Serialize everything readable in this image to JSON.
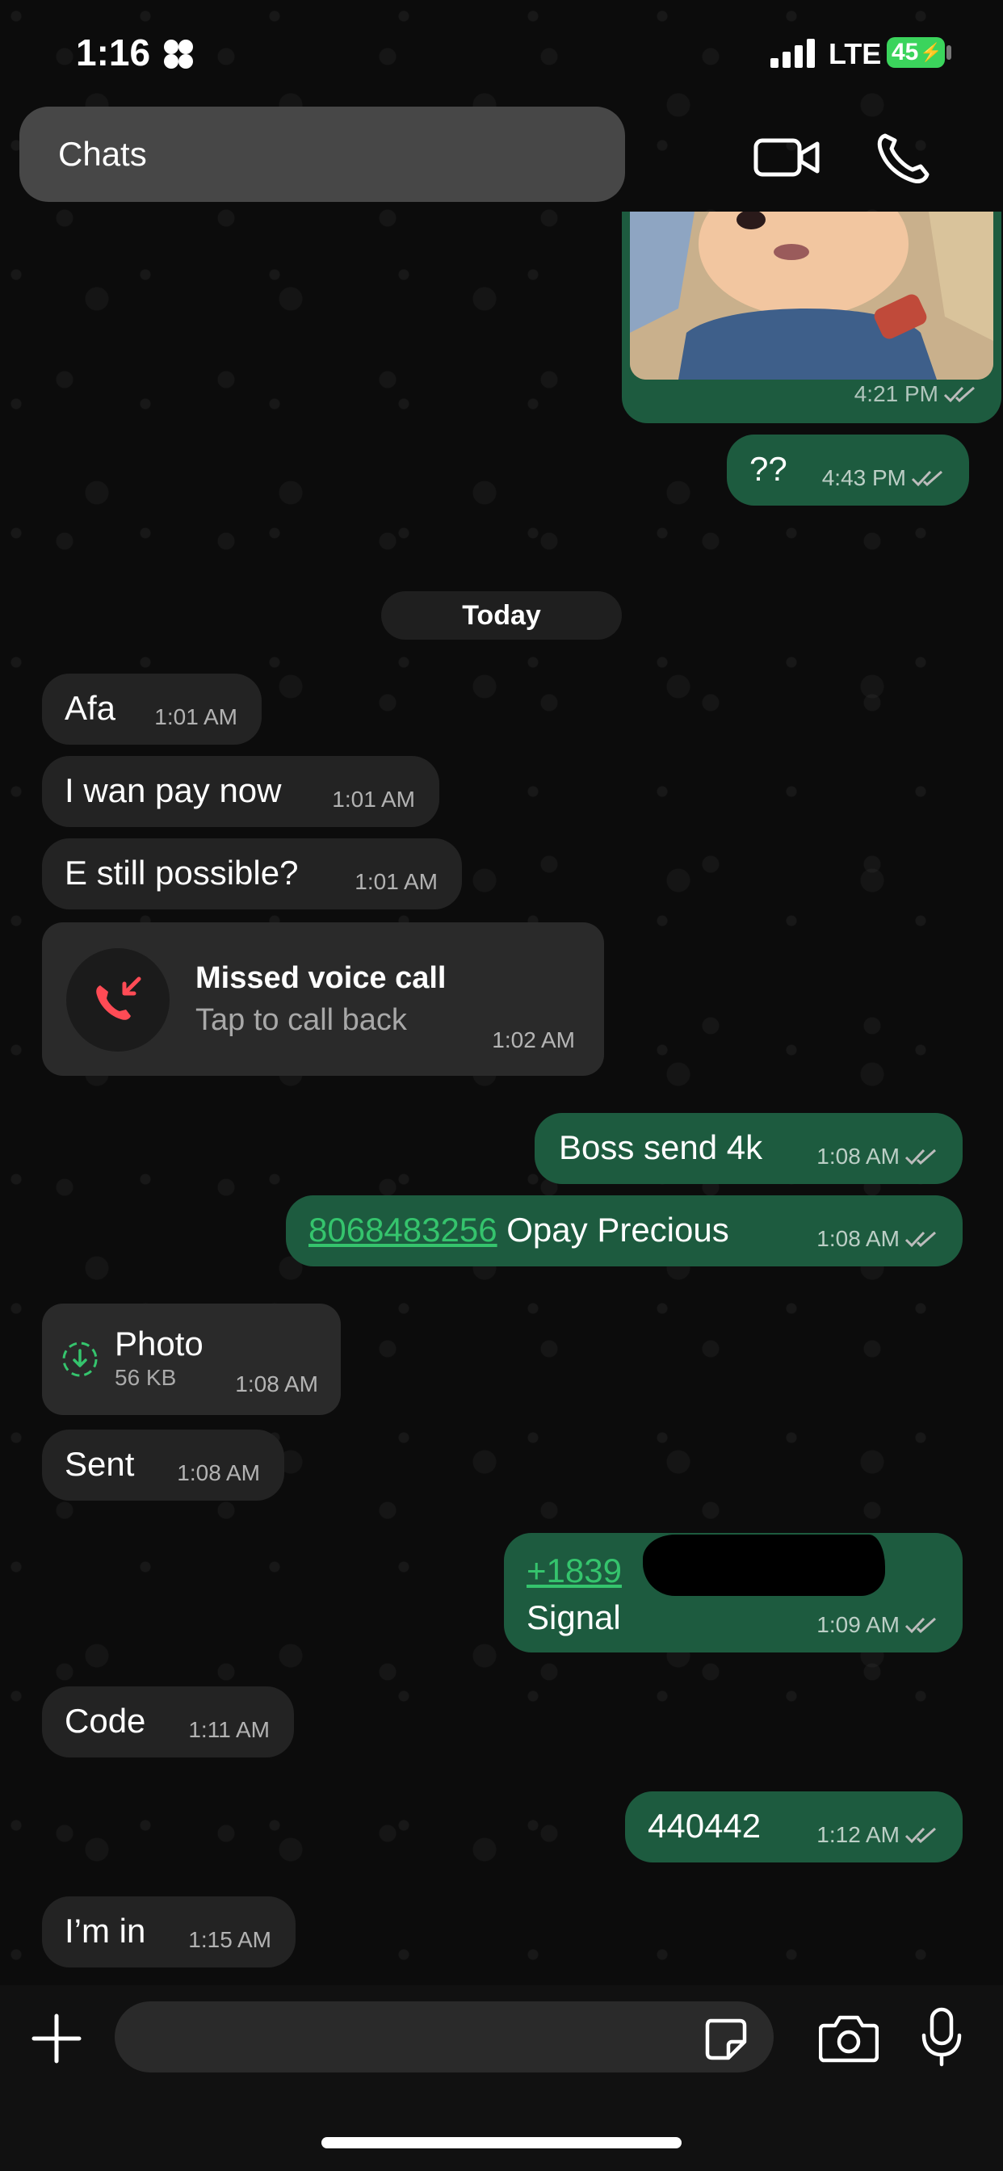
{
  "status_bar": {
    "time": "1:16",
    "network": "LTE",
    "battery": "45"
  },
  "header": {
    "back_label": "Chats",
    "video_icon": "video-camera-icon",
    "call_icon": "phone-icon"
  },
  "date_divider": "Today",
  "messages": [
    {
      "text": "4:21 PM"
    },
    {
      "text": "??",
      "time": "4:43 PM"
    },
    {
      "text": "Afa",
      "time": "1:01 AM"
    },
    {
      "text": "I wan pay now",
      "time": "1:01 AM"
    },
    {
      "text": "E still possible?",
      "time": "1:01 AM"
    },
    {
      "text": "Boss send 4k",
      "time": "1:08 AM"
    },
    {
      "link": "8068483256",
      "text": " Opay Precious",
      "time": "1:08 AM"
    },
    {
      "text": "Sent",
      "time": "1:08 AM"
    },
    {
      "link": "+1839",
      "text": "Signal",
      "time": "1:09 AM"
    },
    {
      "text": "Code",
      "time": "1:11 AM"
    },
    {
      "text": "440442",
      "time": "1:12 AM"
    },
    {
      "text": "I’m in",
      "time": "1:15 AM"
    }
  ],
  "missed_call": {
    "title": "Missed voice call",
    "subtitle": "Tap to call back",
    "time": "1:02 AM"
  },
  "photo": {
    "title": "Photo",
    "size": "56 KB",
    "time": "1:08 AM"
  },
  "colors": {
    "incoming": "#232323",
    "outgoing": "#1d5b3f",
    "link": "#35c46d",
    "missed": "#ff4b55"
  }
}
